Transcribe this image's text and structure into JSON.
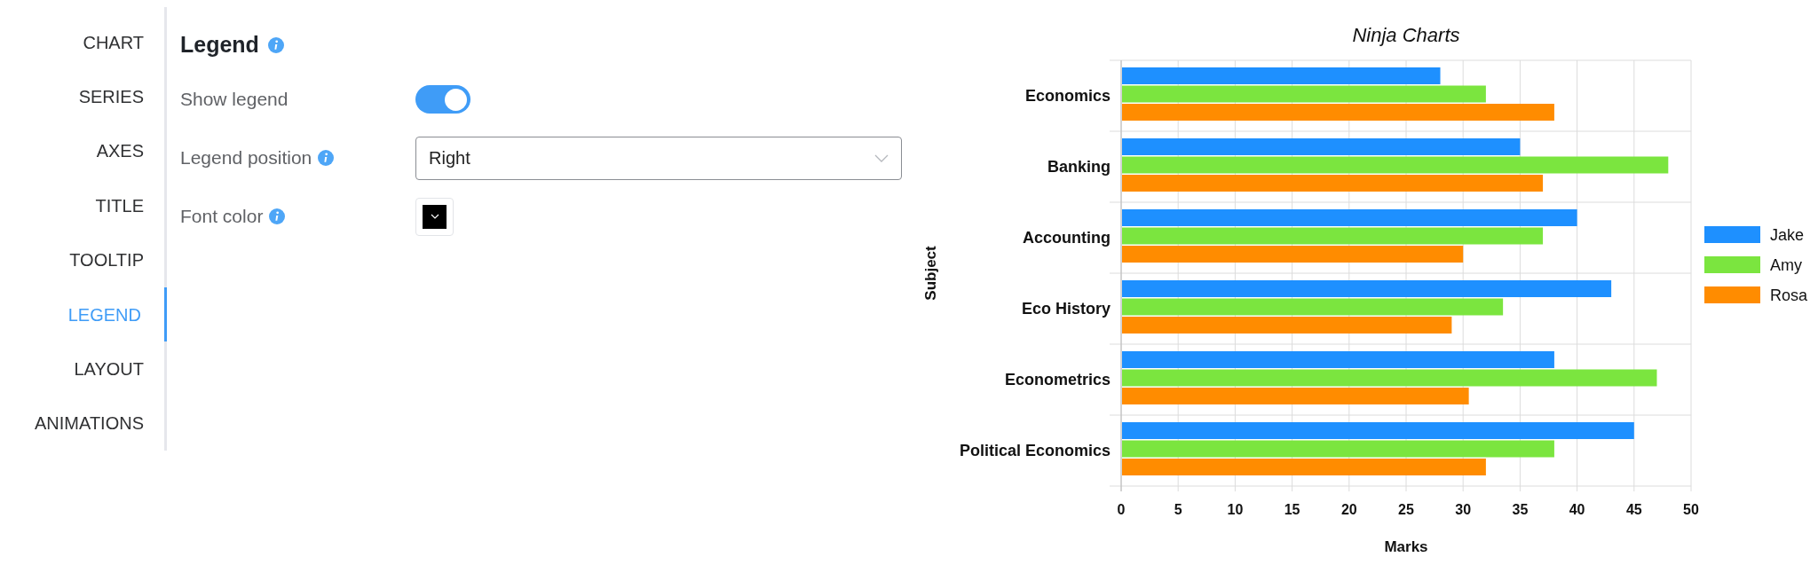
{
  "sidebar": {
    "items": [
      {
        "label": "CHART",
        "selected": false
      },
      {
        "label": "SERIES",
        "selected": false
      },
      {
        "label": "AXES",
        "selected": false
      },
      {
        "label": "TITLE",
        "selected": false
      },
      {
        "label": "TOOLTIP",
        "selected": false
      },
      {
        "label": "LEGEND",
        "selected": true
      },
      {
        "label": "LAYOUT",
        "selected": false
      },
      {
        "label": "ANIMATIONS",
        "selected": false
      }
    ]
  },
  "settings": {
    "title": "Legend",
    "title_info": true,
    "fields": [
      {
        "kind": "toggle",
        "label": "Show legend",
        "info": false,
        "on": true
      },
      {
        "kind": "select",
        "label": "Legend position",
        "info": true,
        "value": "Right"
      },
      {
        "kind": "color",
        "label": "Font color",
        "info": true,
        "color": "#000000"
      }
    ]
  },
  "chart": {
    "chart_data": {
      "type": "bar",
      "orientation": "horizontal",
      "grid": true,
      "legend": true,
      "title": "Ninja Charts",
      "xlabel": "Marks",
      "ylabel": "Subject",
      "categories": [
        "Economics",
        "Banking",
        "Accounting",
        "Eco History",
        "Econometrics",
        "Political Economics"
      ],
      "xlim": [
        0,
        50
      ],
      "xticks": [
        0,
        5,
        10,
        15,
        20,
        25,
        30,
        35,
        40,
        45,
        50
      ],
      "series": [
        {
          "name": "Jake",
          "color": "#1e90ff",
          "values": [
            28,
            35,
            40,
            43,
            38,
            45
          ]
        },
        {
          "name": "Amy",
          "color": "#7be53f",
          "values": [
            32,
            48,
            37,
            33.5,
            47,
            38
          ]
        },
        {
          "name": "Rosa",
          "color": "#ff8c00",
          "values": [
            38,
            37,
            30,
            29,
            30.5,
            32
          ]
        }
      ]
    }
  }
}
